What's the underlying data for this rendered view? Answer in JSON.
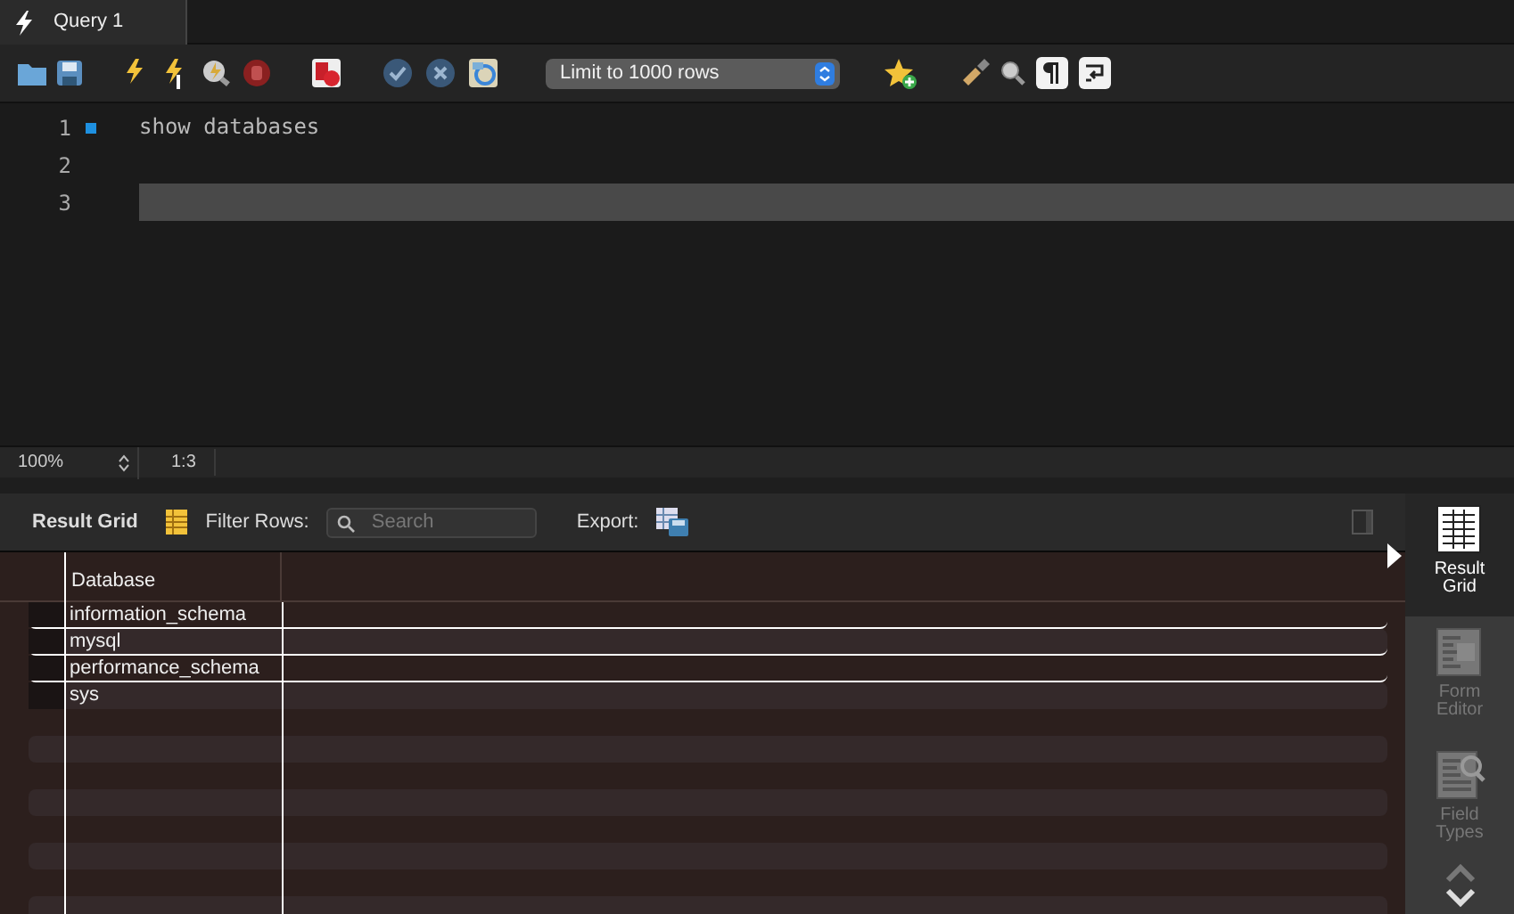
{
  "tabs": [
    {
      "label": "Query 1",
      "selected": true
    }
  ],
  "toolbar": {
    "limit_select": "Limit to 1000 rows"
  },
  "editor": {
    "lines": [
      {
        "number": "1",
        "text": "show databases",
        "marker": true,
        "current": false
      },
      {
        "number": "2",
        "marker": false,
        "current": false
      },
      {
        "number": "3",
        "marker": false,
        "current": true
      }
    ]
  },
  "status": {
    "zoom": "100%",
    "position": "1:3"
  },
  "result": {
    "title": "Result Grid",
    "filter_label": "Filter Rows:",
    "search_placeholder": "Search",
    "export_label": "Export:",
    "columns": [
      "Database"
    ],
    "rows": [
      [
        "information_schema"
      ],
      [
        "mysql"
      ],
      [
        "performance_schema"
      ],
      [
        "sys"
      ]
    ]
  },
  "side_panel": [
    {
      "label": "Result Grid",
      "selected": true
    },
    {
      "label": "Form Editor",
      "selected": false
    },
    {
      "label": "Field Types",
      "selected": false
    }
  ]
}
